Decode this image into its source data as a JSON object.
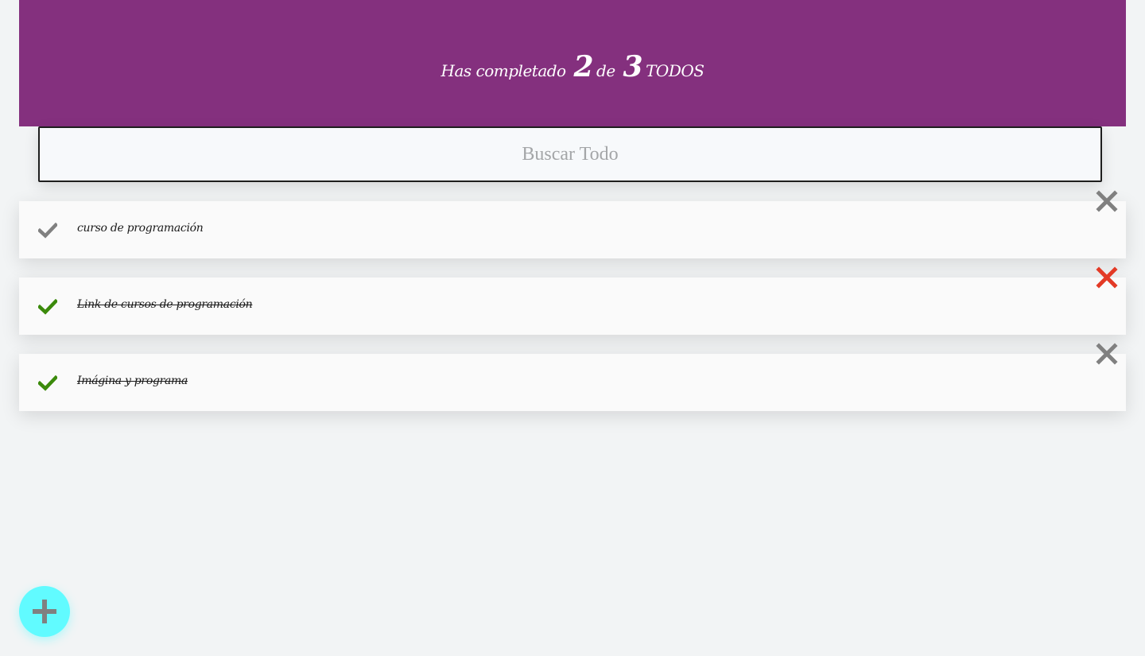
{
  "header": {
    "prefix": "Has completado",
    "completed": "2",
    "connector": "de",
    "total": "3",
    "suffix": "TODOS"
  },
  "search": {
    "placeholder": "Buscar Todo",
    "value": ""
  },
  "todos": [
    {
      "text": "curso de programación",
      "completed": false
    },
    {
      "text": "Link de cursos de programación",
      "completed": true
    },
    {
      "text": "Imágina y programa",
      "completed": true
    }
  ],
  "icons": {
    "check": "check-icon",
    "delete": "close-icon",
    "add": "plus-icon"
  },
  "colors": {
    "header_bg": "#84307e",
    "check_done": "#3b8a0b",
    "check_pending": "#808080",
    "delete_default": "#808080",
    "delete_hover": "#e33a26",
    "fab_bg": "#61fbff",
    "fab_icon": "#808080"
  }
}
